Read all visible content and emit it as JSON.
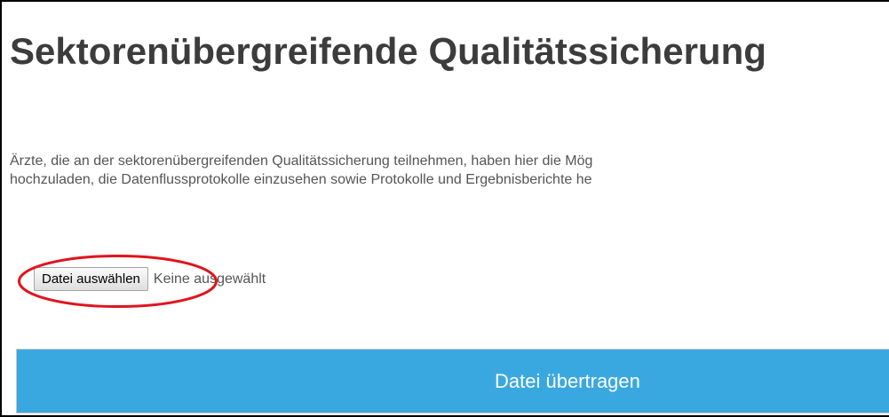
{
  "page": {
    "title": "Sektorenübergreifende Qualitätssicherung",
    "description": [
      "Ärzte, die an der sektorenübergreifenden Qualitätssicherung teilnehmen, haben hier die Mög",
      "hochzuladen, die Datenflussprotokolle einzusehen sowie Protokolle und Ergebnisberichte he"
    ]
  },
  "upload": {
    "choose_label": "Datei auswählen",
    "status_text": "Keine ausgewählt",
    "submit_label": "Datei übertragen"
  },
  "colors": {
    "submit_bg": "#3aa8e0",
    "highlight": "#e0141e"
  }
}
